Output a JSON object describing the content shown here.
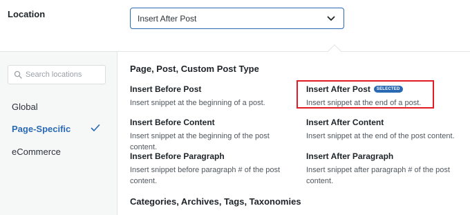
{
  "location": {
    "label": "Location",
    "selected_value": "Insert After Post"
  },
  "sidebar": {
    "search_placeholder": "Search locations",
    "items": [
      {
        "label": "Global"
      },
      {
        "label": "Page-Specific"
      },
      {
        "label": "eCommerce"
      }
    ]
  },
  "main": {
    "sections": [
      {
        "title": "Page, Post, Custom Post Type"
      },
      {
        "title": "Categories, Archives, Tags, Taxonomies"
      }
    ],
    "options": [
      {
        "title": "Insert Before Post",
        "desc": "Insert snippet at the beginning of a post."
      },
      {
        "title": "Insert After Post",
        "desc": "Insert snippet at the end of a post.",
        "badge": "SELECTED"
      },
      {
        "title": "Insert Before Content",
        "desc": "Insert snippet at the beginning of the post content."
      },
      {
        "title": "Insert After Content",
        "desc": "Insert snippet at the end of the post content."
      },
      {
        "title": "Insert Before Paragraph",
        "desc": "Insert snippet before paragraph # of the post content."
      },
      {
        "title": "Insert After Paragraph",
        "desc": "Insert snippet after paragraph # of the post content."
      }
    ]
  },
  "colors": {
    "accent": "#2a6ab3",
    "highlight_border": "#e01b22"
  }
}
